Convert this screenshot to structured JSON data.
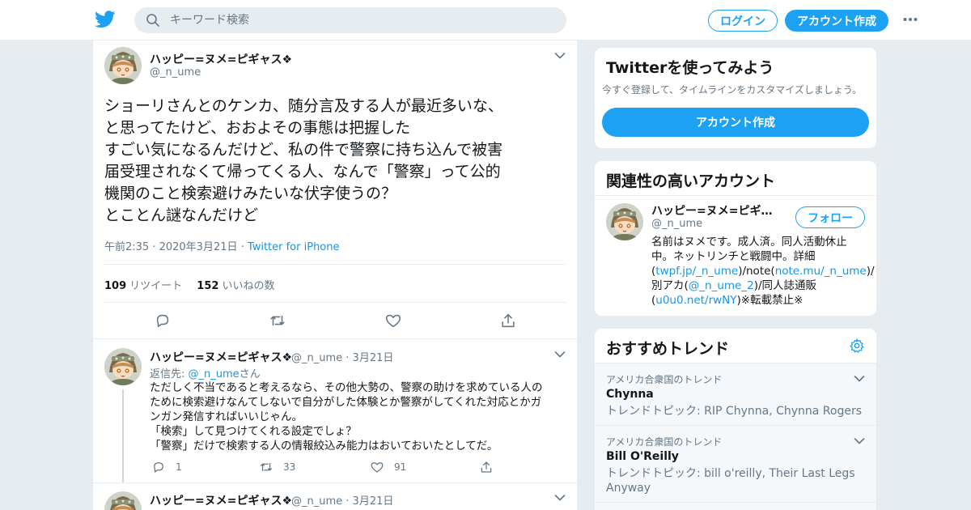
{
  "header": {
    "search_placeholder": "キーワード検索",
    "login_label": "ログイン",
    "signup_label": "アカウント作成"
  },
  "tweet": {
    "author_name": "ハッピー=ヌメ=ピギャス❖",
    "author_handle": "@_n_ume",
    "text_lines": [
      "ショーリさんとのケンカ、随分言及する人が最近多いな、",
      "と思ってたけど、おおよその事態は把握した",
      "すごい気になるんだけど、私の件で警察に持ち込んで被害",
      "届受理されなくて帰ってくる人、なんで「警察」って公的",
      "機関のこと検索避けみたいな伏字使うの？",
      "とことん謎なんだけど"
    ],
    "timestamp": "午前2:35 · 2020年3月21日 ·",
    "source": "Twitter for iPhone",
    "retweet_count": "109",
    "retweet_label": "リツイート",
    "like_count": "152",
    "like_label": "いいねの数"
  },
  "replies": [
    {
      "author_name": "ハッピー=ヌメ=ピギャス❖",
      "author_handle": "@_n_ume",
      "date": "3月21日",
      "reply_to_prefix": "返信先: ",
      "reply_to_handle": "@_n_ume",
      "reply_to_suffix": "さん",
      "body_lines": [
        "ただしく不当であると考えるなら、その他大勢の、警察の助けを求めている人の",
        "ために検索避けなんてしないで自分がした体験とか警察がしてくれた対応とかガ",
        "ンガン発信すればいいじゃん。",
        "「検索」して見つけてくれる設定でしょ？",
        "「警察」だけで検索する人の情報絞込み能力はおいておいたとしてだ。"
      ],
      "reply_count": "1",
      "retweet_count": "33",
      "like_count": "91"
    },
    {
      "author_name": "ハッピー=ヌメ=ピギャス❖",
      "author_handle": "@_n_ume",
      "date": "3月21日"
    }
  ],
  "sidebar": {
    "signup_card": {
      "title": "Twitterを使ってみよう",
      "subtitle": "今すぐ登録して、タイムラインをカスタマイズしましょう。",
      "button_label": "アカウント作成"
    },
    "related": {
      "title": "関連性の高いアカウント",
      "name": "ハッピー=ヌメ=ピギャス❖",
      "handle": "@_n_ume",
      "follow_label": "フォロー",
      "bio": {
        "line1": "名前はヌメです。成人済。同人活動休止",
        "line2": "中。ネットリンチと戦闘中。詳細",
        "line3_open": "(",
        "line3_link1": "twpf.jp/_n_ume",
        "line3_mid": ")/note(",
        "line3_link2": "note.mu/_n_ume",
        "line3_close": ")/",
        "line4_prefix": "別アカ(",
        "line4_link": "@_n_ume_2",
        "line4_suffix": ")/同人誌通販",
        "line5_open": "(",
        "line5_link": "u0u0.net/rwNY",
        "line5_suffix": ")※転載禁止※"
      }
    },
    "trends": {
      "title": "おすすめトレンド",
      "items": [
        {
          "context": "アメリカ合衆国のトレンド",
          "name": "Chynna",
          "desc": "トレンドトピック: RIP Chynna, Chynna Rogers"
        },
        {
          "context": "アメリカ合衆国のトレンド",
          "name": "Bill O'Reilly",
          "desc": "トレンドトピック: bill o'reilly, Their Last Legs Anyway"
        }
      ]
    }
  },
  "colors": {
    "brand": "#1da1f2",
    "link": "#1b95e0",
    "secondary_text": "#657786",
    "background": "#e6ecf0"
  },
  "icons": [
    "twitter-bird-icon",
    "search-icon",
    "more-dots-icon",
    "chevron-down-icon",
    "reply-icon",
    "retweet-icon",
    "like-icon",
    "share-icon",
    "gear-icon"
  ]
}
